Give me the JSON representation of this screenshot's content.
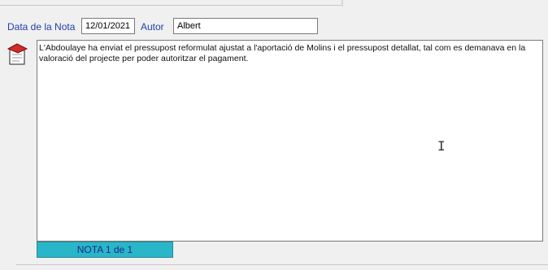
{
  "header": {
    "date_label": "Data de la Nota",
    "date_value": "12/01/2021",
    "author_label": "Autor",
    "author_value": "Albert"
  },
  "note": {
    "icon": "note-icon",
    "text": "L'Abdoulaye ha enviat el pressupost reformulat ajustat a l'aportació de Molins i el pressupost detallat, tal com es demanava en la valoració del projecte per poder autoritzar el pagament."
  },
  "footer": {
    "nota_counter": "NOTA 1 de 1"
  },
  "colors": {
    "label_blue": "#1f3fa8",
    "counter_bg": "#29b6c8",
    "icon_red": "#d42a2a"
  }
}
